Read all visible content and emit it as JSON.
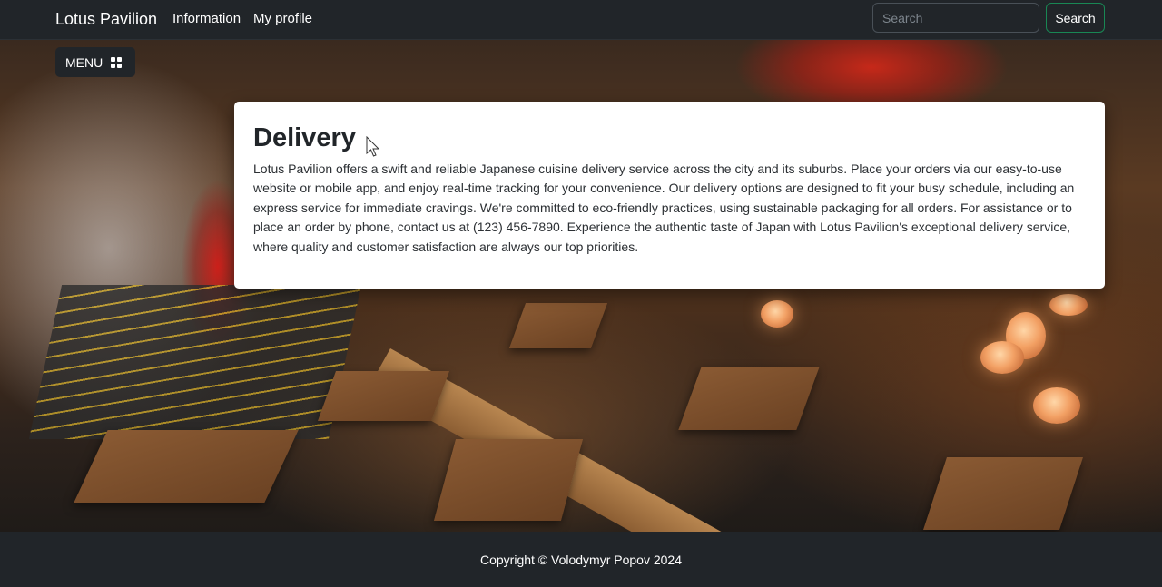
{
  "navbar": {
    "brand": "Lotus Pavilion",
    "links": [
      "Information",
      "My profile"
    ],
    "search_placeholder": "Search",
    "search_button": "Search"
  },
  "menu_button": {
    "label": "MENU",
    "icon": "grid-icon"
  },
  "card": {
    "title": "Delivery",
    "body": "Lotus Pavilion offers a swift and reliable Japanese cuisine delivery service across the city and its suburbs. Place your orders via our easy-to-use website or mobile app, and enjoy real-time tracking for your convenience. Our delivery options are designed to fit your busy schedule, including an express service for immediate cravings. We're committed to eco-friendly practices, using sustainable packaging for all orders. For assistance or to place an order by phone, contact us at (123) 456-7890. Experience the authentic taste of Japan with Lotus Pavilion's exceptional delivery service, where quality and customer satisfaction are always our top priorities."
  },
  "footer": {
    "copyright": "Copyright © Volodymyr Popov 2024"
  },
  "colors": {
    "navbar_bg": "#212529",
    "search_button_border": "#198754",
    "card_bg": "#ffffff"
  }
}
